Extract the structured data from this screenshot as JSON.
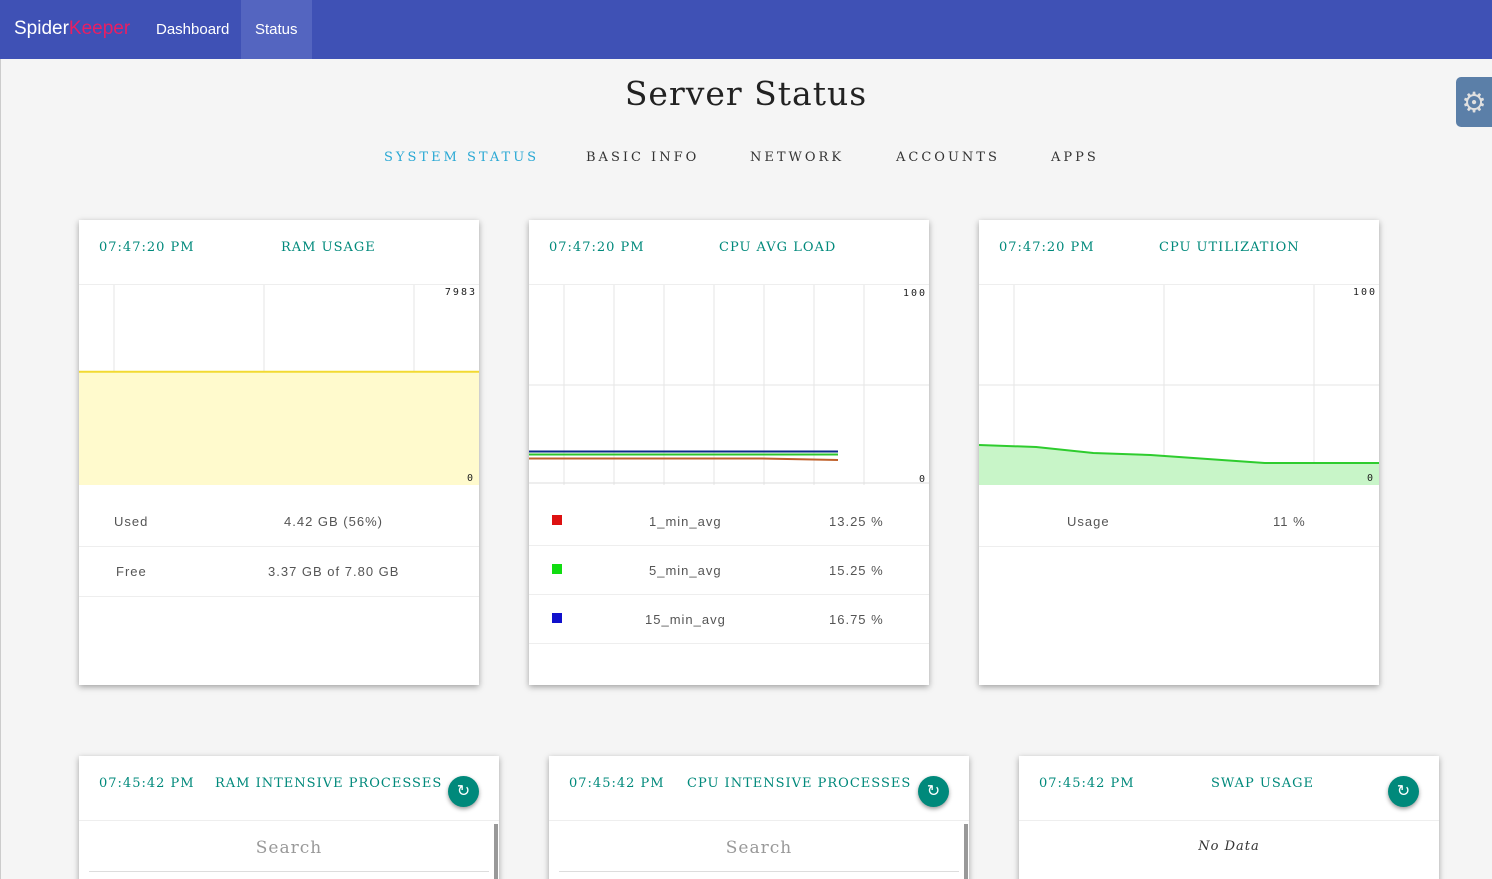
{
  "nav": {
    "brand_part1": "Spider",
    "brand_part2": "Keeper",
    "items": [
      {
        "label": "Dashboard"
      },
      {
        "label": "Status"
      }
    ]
  },
  "page": {
    "title": "Server Status",
    "tabs": [
      {
        "label": "SYSTEM STATUS"
      },
      {
        "label": "BASIC INFO"
      },
      {
        "label": "NETWORK"
      },
      {
        "label": "ACCOUNTS"
      },
      {
        "label": "APPS"
      }
    ]
  },
  "colors": {
    "navbar": "#3f51b5",
    "accent_teal": "#00897b",
    "active_tab": "#29a8d4",
    "ram_fill": "#fffacd",
    "ram_line": "#f2d932",
    "cpu_util_fill": "#c8f5c8",
    "cpu_util_line": "#2ecc2e"
  },
  "ram_card": {
    "time": "07:47:20 PM",
    "title": "RAM USAGE",
    "y_max": "7983",
    "y_min": "0",
    "rows": [
      {
        "label": "Used",
        "value": "4.42 GB (56%)"
      },
      {
        "label": "Free",
        "value": "3.37 GB of 7.80 GB"
      }
    ]
  },
  "cpu_load_card": {
    "time": "07:47:20 PM",
    "title": "CPU AVG LOAD",
    "y_max": "100",
    "y_min": "0",
    "rows": [
      {
        "label": "1_min_avg",
        "value": "13.25 %",
        "color": "#dd1111"
      },
      {
        "label": "5_min_avg",
        "value": "15.25 %",
        "color": "#11dd11"
      },
      {
        "label": "15_min_avg",
        "value": "16.75 %",
        "color": "#1111cc"
      }
    ]
  },
  "cpu_util_card": {
    "time": "07:47:20 PM",
    "title": "CPU UTILIZATION",
    "y_max": "100",
    "y_min": "0",
    "rows": [
      {
        "label": "Usage",
        "value": "11 %"
      }
    ]
  },
  "ram_proc_card": {
    "time": "07:45:42 PM",
    "title": "RAM INTENSIVE PROCESSES",
    "search_placeholder": "Search"
  },
  "cpu_proc_card": {
    "time": "07:45:42 PM",
    "title": "CPU INTENSIVE PROCESSES",
    "search_placeholder": "Search"
  },
  "swap_card": {
    "time": "07:45:42 PM",
    "title": "SWAP USAGE",
    "empty_text": "No Data"
  },
  "chart_data": [
    {
      "type": "area",
      "title": "RAM USAGE",
      "ylim": [
        0,
        7983
      ],
      "series": [
        {
          "name": "Used",
          "values": [
            4520,
            4520,
            4520,
            4520,
            4520
          ]
        }
      ]
    },
    {
      "type": "line",
      "title": "CPU AVG LOAD",
      "ylim": [
        0,
        100
      ],
      "series": [
        {
          "name": "1_min_avg",
          "values": [
            13.25,
            13.25,
            13.25,
            13.25,
            12.5
          ]
        },
        {
          "name": "5_min_avg",
          "values": [
            15.25,
            15.25,
            15.25,
            15.25,
            15.25
          ]
        },
        {
          "name": "15_min_avg",
          "values": [
            16.75,
            16.75,
            16.75,
            16.75,
            16.75
          ]
        }
      ]
    },
    {
      "type": "area",
      "title": "CPU UTILIZATION",
      "ylim": [
        0,
        100
      ],
      "series": [
        {
          "name": "Usage",
          "values": [
            20,
            19,
            16,
            15,
            13,
            11,
            11,
            11
          ]
        }
      ]
    }
  ]
}
